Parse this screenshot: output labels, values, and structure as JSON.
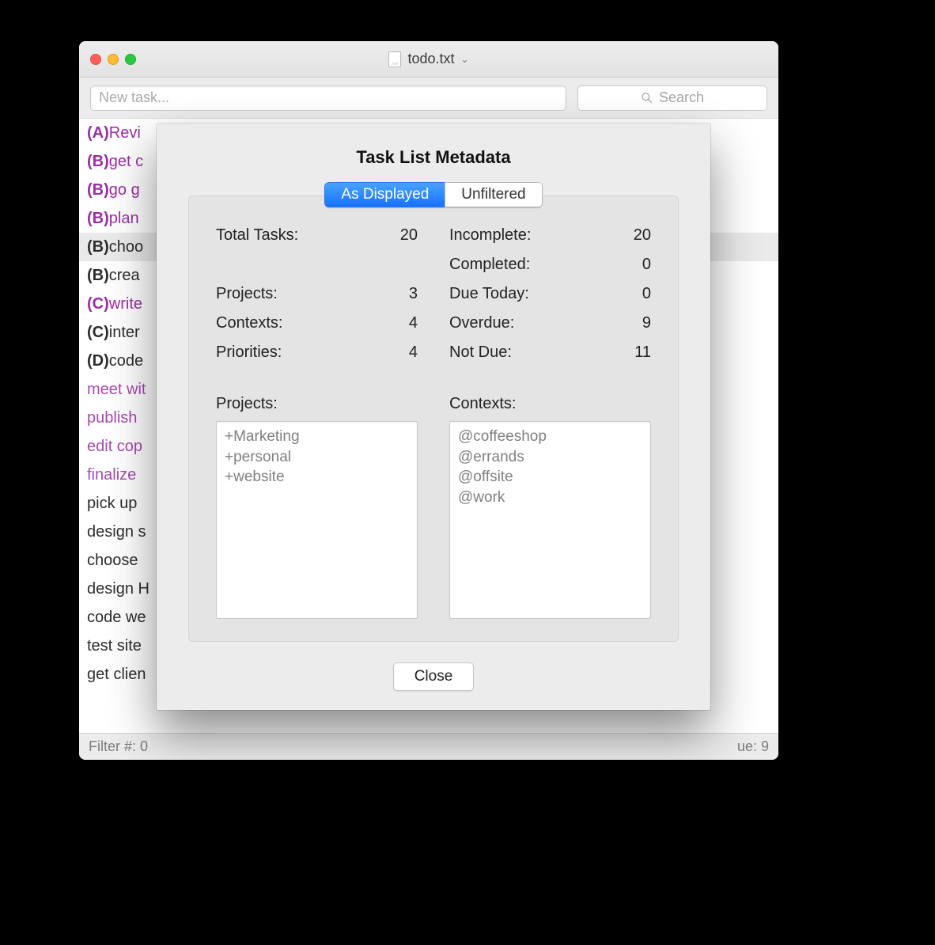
{
  "window": {
    "title": "todo.txt",
    "newtask_placeholder": "New task...",
    "search_placeholder": "Search"
  },
  "tasks": [
    {
      "priority": "(A)",
      "text": "Revi",
      "purple": true
    },
    {
      "priority": "(B)",
      "text": "get c",
      "purple": true
    },
    {
      "priority": "(B)",
      "text": "go g",
      "purple": true
    },
    {
      "priority": "(B)",
      "text": "plan",
      "purple": true
    },
    {
      "priority": "(B)",
      "text": "choo",
      "purple": false,
      "selected": true
    },
    {
      "priority": "(B)",
      "text": "crea",
      "purple": false
    },
    {
      "priority": "(C)",
      "text": "write",
      "purple": true
    },
    {
      "priority": "(C)",
      "text": "inter",
      "purple": false
    },
    {
      "priority": "(D)",
      "text": "code",
      "purple": false
    },
    {
      "priority": "",
      "text": "meet wit",
      "purple": true,
      "light": true
    },
    {
      "priority": "",
      "text": "publish",
      "purple": true,
      "light": true
    },
    {
      "priority": "",
      "text": "edit cop",
      "purple": true,
      "light": true
    },
    {
      "priority": "",
      "text": "finalize",
      "purple": true,
      "light": true
    },
    {
      "priority": "",
      "text": "pick up",
      "purple": false
    },
    {
      "priority": "",
      "text": "design s",
      "purple": false
    },
    {
      "priority": "",
      "text": "choose",
      "purple": false
    },
    {
      "priority": "",
      "text": "design H",
      "purple": false
    },
    {
      "priority": "",
      "text": "code we",
      "purple": false
    },
    {
      "priority": "",
      "text": "test site",
      "purple": false
    },
    {
      "priority": "",
      "text": "get clien",
      "purple": false
    }
  ],
  "statusbar": {
    "left": "Filter #: 0",
    "right": "ue: 9"
  },
  "sheet": {
    "title": "Task List Metadata",
    "tabs": {
      "active": "As Displayed",
      "inactive": "Unfiltered"
    },
    "stats": {
      "total_label": "Total Tasks:",
      "total": "20",
      "incomplete_label": "Incomplete:",
      "incomplete": "20",
      "completed_label": "Completed:",
      "completed": "0",
      "projects_label": "Projects:",
      "projects_count": "3",
      "duetoday_label": "Due Today:",
      "duetoday": "0",
      "contexts_label": "Contexts:",
      "contexts_count": "4",
      "overdue_label": "Overdue:",
      "overdue": "9",
      "priorities_label": "Priorities:",
      "priorities": "4",
      "notdue_label": "Not Due:",
      "notdue": "11"
    },
    "projects_header": "Projects:",
    "contexts_header": "Contexts:",
    "projects": [
      "+Marketing",
      "+personal",
      "+website"
    ],
    "contexts": [
      "@coffeeshop",
      "@errands",
      "@offsite",
      "@work"
    ],
    "close": "Close"
  }
}
